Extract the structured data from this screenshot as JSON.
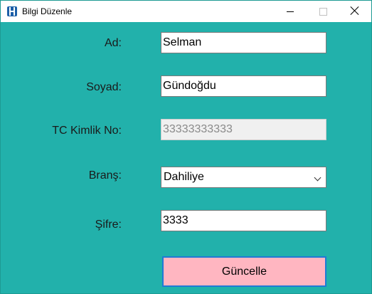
{
  "window": {
    "title": "Bilgi Düzenle",
    "icon": "app-h-icon"
  },
  "form": {
    "ad_label": "Ad:",
    "ad_value": "Selman",
    "soyad_label": "Soyad:",
    "soyad_value": "Gündoğdu",
    "tc_label": "TC Kimlik No:",
    "tc_value": "33333333333",
    "brans_label": "Branş:",
    "brans_value": "Dahiliye",
    "sifre_label": "Şifre:",
    "sifre_value": "3333",
    "update_button": "Güncelle"
  },
  "colors": {
    "background": "#22b1ab",
    "button": "#ffb6c1",
    "button_border": "#1f7ad6"
  }
}
